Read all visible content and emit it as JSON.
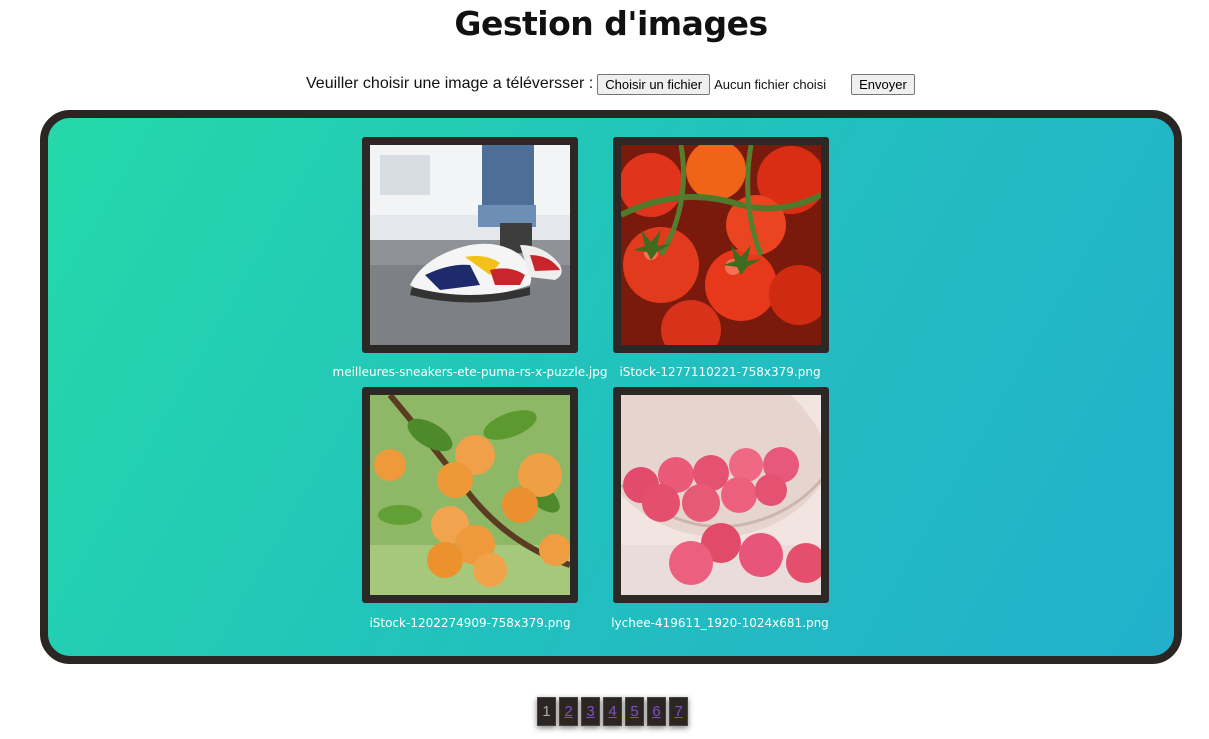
{
  "page": {
    "title": "Gestion d'images"
  },
  "upload": {
    "label": "Veuiller choisir une image a téléversser :",
    "choose_label": "Choisir un fichier",
    "file_status": "Aucun fichier choisi",
    "submit_label": "Envoyer"
  },
  "gallery": {
    "images": [
      {
        "caption": "meilleures-sneakers-ete-puma-rs-x-puzzle.jpg",
        "icon": "sneakers-photo"
      },
      {
        "caption": "iStock-1277110221-758x379.png",
        "icon": "tomatoes-photo"
      },
      {
        "caption": "iStock-1202274909-758x379.png",
        "icon": "apricots-photo"
      },
      {
        "caption": "lychee-419611_1920-1024x681.png",
        "icon": "lychees-photo"
      }
    ]
  },
  "pagination": {
    "current": 1,
    "pages": [
      "1",
      "2",
      "3",
      "4",
      "5",
      "6",
      "7"
    ]
  },
  "colors": {
    "gallery_gradient_start": "#24d9a9",
    "gallery_gradient_end": "#22b0cc",
    "frame_border": "#2c2826",
    "page_link": "#7c4fc8"
  }
}
